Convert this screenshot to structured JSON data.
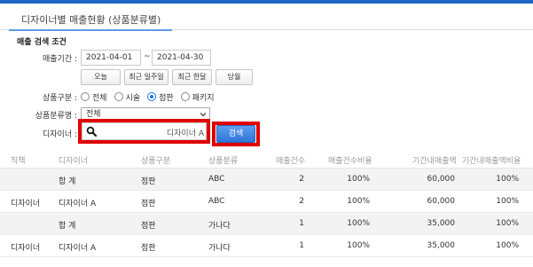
{
  "tab": {
    "title": "디자이너별 매출현황 (상품분류별)"
  },
  "filters": {
    "section_title": "매출 검색 조건",
    "period_label": "매출기간 :",
    "date_from": "2021-04-01",
    "date_to": "2021-04-30",
    "tilde": "~",
    "quick_buttons": [
      "오늘",
      "최근 일주일",
      "최근 한달",
      "당월"
    ],
    "product_type_label": "상품구분 :",
    "product_type_options": [
      "전체",
      "시술",
      "점판",
      "패키지"
    ],
    "product_type_selected": "점판",
    "category_label": "상품분류명 :",
    "category_value": "전체",
    "designer_label": "디자이너 :",
    "designer_value": "디자이너 A",
    "search_button": "검색"
  },
  "table": {
    "headers": [
      "직책",
      "디자이너",
      "상품구분",
      "상품분류",
      "매출건수",
      "매출건수비율",
      "기간내매출액",
      "기간내매출액비율"
    ],
    "rows": [
      {
        "position": "",
        "designer": "합 계",
        "product_type": "점판",
        "category": "ABC",
        "count": "2",
        "count_ratio": "100%",
        "amount": "60,000",
        "amount_ratio": "100%",
        "shade": true
      },
      {
        "position": "디자이너",
        "designer": "디자이너 A",
        "product_type": "점판",
        "category": "ABC",
        "count": "2",
        "count_ratio": "100%",
        "amount": "60,000",
        "amount_ratio": "100%",
        "shade": false
      },
      {
        "position": "",
        "designer": "합 계",
        "product_type": "점판",
        "category": "가나다",
        "count": "1",
        "count_ratio": "100%",
        "amount": "35,000",
        "amount_ratio": "100%",
        "shade": true
      },
      {
        "position": "디자이너",
        "designer": "디자이너 A",
        "product_type": "점판",
        "category": "가나다",
        "count": "1",
        "count_ratio": "100%",
        "amount": "35,000",
        "amount_ratio": "100%",
        "shade": false
      }
    ]
  },
  "colors": {
    "accent": "#1f63c4",
    "highlight": "#e00000",
    "button_blue": "#2f74d8"
  },
  "icons": {
    "search": "search-icon",
    "dropdown": "chevron-down-icon"
  }
}
